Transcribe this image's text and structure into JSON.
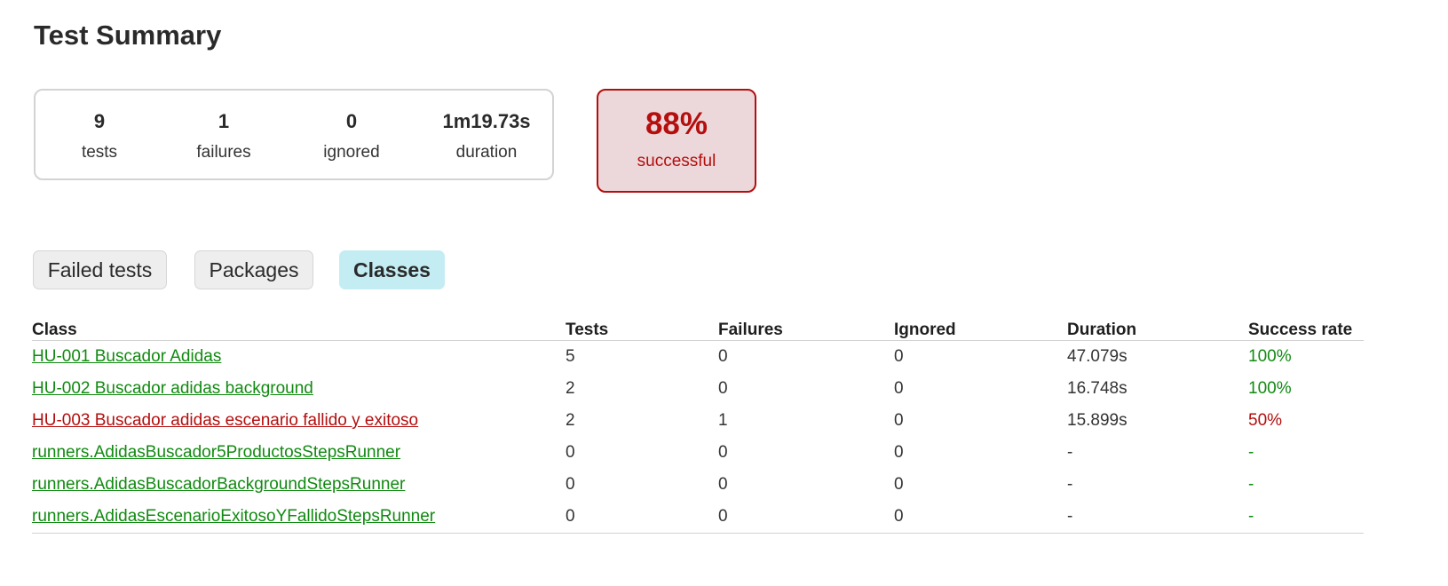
{
  "title": "Test Summary",
  "summary": {
    "tests": {
      "value": "9",
      "label": "tests"
    },
    "failures": {
      "value": "1",
      "label": "failures"
    },
    "ignored": {
      "value": "0",
      "label": "ignored"
    },
    "duration": {
      "value": "1m19.73s",
      "label": "duration"
    }
  },
  "success": {
    "value": "88%",
    "label": "successful"
  },
  "tabs": [
    {
      "label": "Failed tests",
      "active": false
    },
    {
      "label": "Packages",
      "active": false
    },
    {
      "label": "Classes",
      "active": true
    }
  ],
  "table": {
    "headers": [
      "Class",
      "Tests",
      "Failures",
      "Ignored",
      "Duration",
      "Success rate"
    ],
    "rows": [
      {
        "class": "HU-001 Buscador Adidas",
        "tests": "5",
        "failures": "0",
        "ignored": "0",
        "duration": "47.079s",
        "rate": "100%",
        "status": "success"
      },
      {
        "class": "HU-002 Buscador adidas background",
        "tests": "2",
        "failures": "0",
        "ignored": "0",
        "duration": "16.748s",
        "rate": "100%",
        "status": "success"
      },
      {
        "class": "HU-003 Buscador adidas escenario fallido y exitoso",
        "tests": "2",
        "failures": "1",
        "ignored": "0",
        "duration": "15.899s",
        "rate": "50%",
        "status": "failure"
      },
      {
        "class": "runners.AdidasBuscador5ProductosStepsRunner",
        "tests": "0",
        "failures": "0",
        "ignored": "0",
        "duration": "-",
        "rate": "-",
        "status": "success"
      },
      {
        "class": "runners.AdidasBuscadorBackgroundStepsRunner",
        "tests": "0",
        "failures": "0",
        "ignored": "0",
        "duration": "-",
        "rate": "-",
        "status": "success"
      },
      {
        "class": "runners.AdidasEscenarioExitosoYFallidoStepsRunner",
        "tests": "0",
        "failures": "0",
        "ignored": "0",
        "duration": "-",
        "rate": "-",
        "status": "success"
      }
    ]
  },
  "colors": {
    "success": "#118a11",
    "failure": "#b40e0e",
    "active_tab": "#c3ecf3",
    "rate_box_bg": "#ecd8da"
  }
}
